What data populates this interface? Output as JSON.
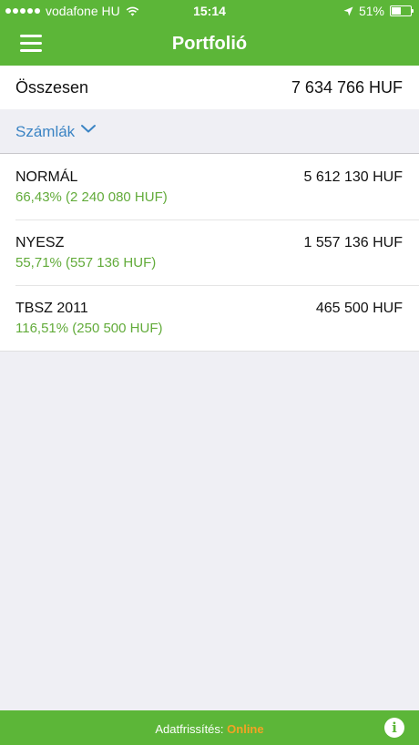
{
  "status_bar": {
    "carrier": "vodafone HU",
    "time": "15:14",
    "battery": "51%",
    "battery_level": 0.51
  },
  "header": {
    "title": "Portfolió"
  },
  "summary": {
    "label": "Összesen",
    "value": "7 634 766 HUF"
  },
  "section": {
    "label": "Számlák"
  },
  "accounts": [
    {
      "name": "NORMÁL",
      "amount": "5 612 130 HUF",
      "change": "66,43% (2 240 080 HUF)"
    },
    {
      "name": "NYESZ",
      "amount": "1 557 136 HUF",
      "change": "55,71% (557 136 HUF)"
    },
    {
      "name": "TBSZ 2011",
      "amount": "465 500 HUF",
      "change": "116,51% (250 500 HUF)"
    }
  ],
  "footer": {
    "label": "Adatfrissítés:",
    "mode": "Online",
    "info_glyph": "i"
  },
  "colors": {
    "brand_green": "#5cb638",
    "link_blue": "#3b84c4",
    "positive": "#62ab3a",
    "realtime": "#f4a224"
  }
}
